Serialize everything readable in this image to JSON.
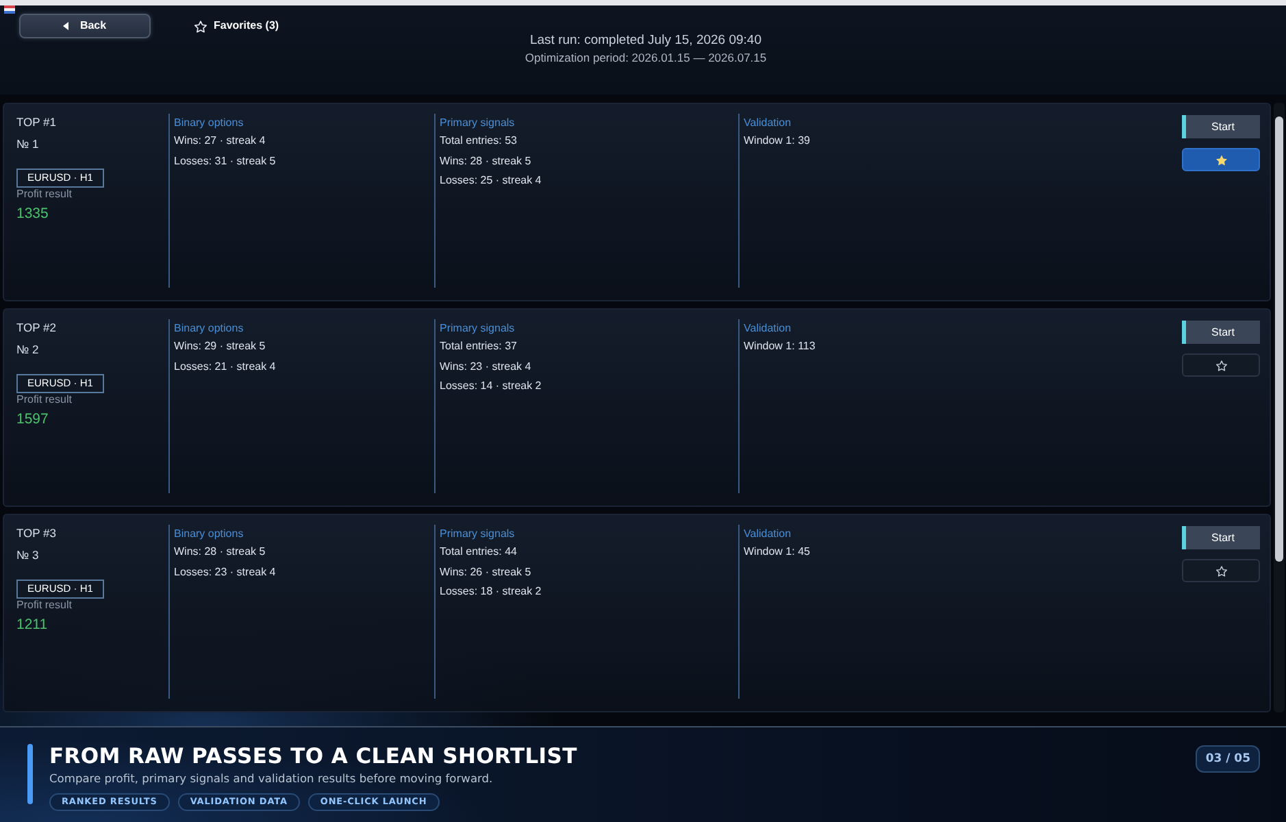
{
  "header": {
    "back_button": "Back",
    "favorites": "Favorites (3)",
    "last_run": "Last run: completed July 15, 2026 09:40",
    "period": "Optimization period: 2026.01.15 — 2026.07.15"
  },
  "results": [
    {
      "rank": "TOP #1",
      "number": "№ 1",
      "symbol": "EURUSD · H1",
      "profit_label": "Profit result",
      "profit": "1335",
      "sections": [
        {
          "title": "Binary options",
          "lines": [
            "Wins: 27 · streak 4",
            "Losses: 31 · streak 5"
          ]
        },
        {
          "title": "Primary signals",
          "lines": [
            "Total entries: 53",
            "Wins: 28 · streak 5",
            "Losses: 25 · streak 4"
          ]
        },
        {
          "title": "Validation",
          "lines": [
            "Window 1: 39"
          ]
        }
      ],
      "start_button": "Start",
      "favorite": true
    },
    {
      "rank": "TOP #2",
      "number": "№ 2",
      "symbol": "EURUSD · H1",
      "profit_label": "Profit result",
      "profit": "1597",
      "sections": [
        {
          "title": "Binary options",
          "lines": [
            "Wins: 29 · streak 5",
            "Losses: 21 · streak 4"
          ]
        },
        {
          "title": "Primary signals",
          "lines": [
            "Total entries: 37",
            "Wins: 23 · streak 4",
            "Losses: 14 · streak 2"
          ]
        },
        {
          "title": "Validation",
          "lines": [
            "Window 1: 113"
          ]
        }
      ],
      "start_button": "Start",
      "favorite": false
    },
    {
      "rank": "TOP #3",
      "number": "№ 3",
      "symbol": "EURUSD · H1",
      "profit_label": "Profit result",
      "profit": "1211",
      "sections": [
        {
          "title": "Binary options",
          "lines": [
            "Wins: 28 · streak 5",
            "Losses: 23 · streak 4"
          ]
        },
        {
          "title": "Primary signals",
          "lines": [
            "Total entries: 44",
            "Wins: 26 · streak 5",
            "Losses: 18 · streak 2"
          ]
        },
        {
          "title": "Validation",
          "lines": [
            "Window 1: 45"
          ]
        }
      ],
      "start_button": "Start",
      "favorite": false
    }
  ],
  "banner": {
    "title": "FROM RAW PASSES TO A CLEAN SHORTLIST",
    "subtitle": "Compare profit, primary signals and validation results before moving forward.",
    "tags": [
      "RANKED RESULTS",
      "VALIDATION DATA",
      "ONE-CLICK LAUNCH"
    ],
    "page": "03 / 05"
  }
}
